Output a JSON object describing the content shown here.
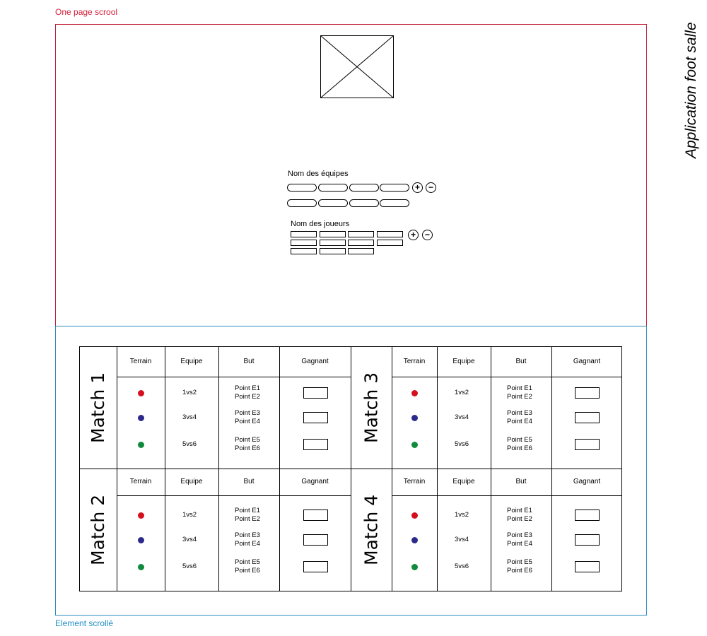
{
  "labels": {
    "top": "One page scrool",
    "bottom": "Element scrollé",
    "side_title": "Application foot salle"
  },
  "colors": {
    "red_frame": "#c0243a",
    "blue_frame": "#2a8fc1"
  },
  "form": {
    "teams_label": "Nom des équipes",
    "players_label": "Nom des joueurs",
    "add_symbol": "+",
    "remove_symbol": "−"
  },
  "table": {
    "headers": [
      "Terrain",
      "Equipe",
      "But",
      "Gagnant"
    ],
    "matches": [
      {
        "title": "Match 1",
        "rows": [
          {
            "terrain_color": "#d4101f",
            "equipe": "1vs2",
            "but": [
              "Point E1",
              "Point E2"
            ]
          },
          {
            "terrain_color": "#2b2a8a",
            "equipe": "3vs4",
            "but": [
              "Point E3",
              "Point E4"
            ]
          },
          {
            "terrain_color": "#108a3c",
            "equipe": "5vs6",
            "but": [
              "Point E5",
              "Point E6"
            ]
          }
        ]
      },
      {
        "title": "Match 2",
        "rows": [
          {
            "terrain_color": "#d4101f",
            "equipe": "1vs2",
            "but": [
              "Point E1",
              "Point E2"
            ]
          },
          {
            "terrain_color": "#2b2a8a",
            "equipe": "3vs4",
            "but": [
              "Point E3",
              "Point E4"
            ]
          },
          {
            "terrain_color": "#108a3c",
            "equipe": "5vs6",
            "but": [
              "Point E5",
              "Point E6"
            ]
          }
        ]
      },
      {
        "title": "Match 3",
        "rows": [
          {
            "terrain_color": "#d4101f",
            "equipe": "1vs2",
            "but": [
              "Point E1",
              "Point E2"
            ]
          },
          {
            "terrain_color": "#2b2a8a",
            "equipe": "3vs4",
            "but": [
              "Point E3",
              "Point E4"
            ]
          },
          {
            "terrain_color": "#108a3c",
            "equipe": "5vs6",
            "but": [
              "Point E5",
              "Point E6"
            ]
          }
        ]
      },
      {
        "title": "Match 4",
        "rows": [
          {
            "terrain_color": "#d4101f",
            "equipe": "1vs2",
            "but": [
              "Point E1",
              "Point E2"
            ]
          },
          {
            "terrain_color": "#2b2a8a",
            "equipe": "3vs4",
            "but": [
              "Point E3",
              "Point E4"
            ]
          },
          {
            "terrain_color": "#108a3c",
            "equipe": "5vs6",
            "but": [
              "Point E5",
              "Point E6"
            ]
          }
        ]
      }
    ]
  }
}
